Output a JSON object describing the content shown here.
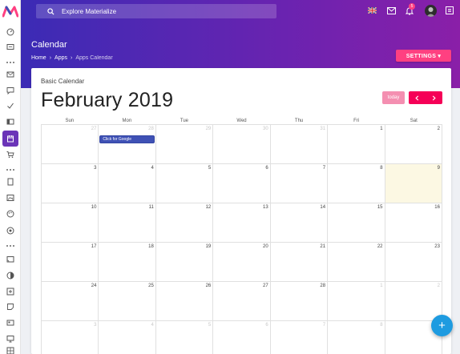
{
  "header": {
    "search_placeholder": "Explore Materialize",
    "notification_count": "5"
  },
  "page": {
    "title": "Calendar",
    "breadcrumb": [
      "Home",
      "Apps",
      "Apps Calendar"
    ],
    "settings_label": "SETTINGS ▾"
  },
  "calendar": {
    "card_title": "Basic Calendar",
    "month_label": "February 2019",
    "today_label": "today",
    "weekdays": [
      "Sun",
      "Mon",
      "Tue",
      "Wed",
      "Thu",
      "Fri",
      "Sat"
    ],
    "weeks": [
      [
        {
          "n": "27",
          "other": true
        },
        {
          "n": "28",
          "other": true,
          "event": "Click for Google"
        },
        {
          "n": "29",
          "other": true
        },
        {
          "n": "30",
          "other": true
        },
        {
          "n": "31",
          "other": true
        },
        {
          "n": "1"
        },
        {
          "n": "2"
        }
      ],
      [
        {
          "n": "3"
        },
        {
          "n": "4"
        },
        {
          "n": "5"
        },
        {
          "n": "6"
        },
        {
          "n": "7"
        },
        {
          "n": "8"
        },
        {
          "n": "9",
          "today": true
        }
      ],
      [
        {
          "n": "10"
        },
        {
          "n": "11"
        },
        {
          "n": "12"
        },
        {
          "n": "13"
        },
        {
          "n": "14"
        },
        {
          "n": "15"
        },
        {
          "n": "16"
        }
      ],
      [
        {
          "n": "17"
        },
        {
          "n": "18"
        },
        {
          "n": "19"
        },
        {
          "n": "20"
        },
        {
          "n": "21"
        },
        {
          "n": "22"
        },
        {
          "n": "23"
        }
      ],
      [
        {
          "n": "24"
        },
        {
          "n": "25"
        },
        {
          "n": "26"
        },
        {
          "n": "27"
        },
        {
          "n": "28"
        },
        {
          "n": "1",
          "other": true
        },
        {
          "n": "2",
          "other": true
        }
      ],
      [
        {
          "n": "3",
          "other": true
        },
        {
          "n": "4",
          "other": true
        },
        {
          "n": "5",
          "other": true
        },
        {
          "n": "6",
          "other": true
        },
        {
          "n": "7",
          "other": true
        },
        {
          "n": "8",
          "other": true
        },
        {
          "n": "9",
          "other": true
        }
      ]
    ]
  },
  "fab_label": "+",
  "colors": {
    "header_gradient_start": "#3b2bb5",
    "header_gradient_end": "#8a1fa8",
    "accent_pink": "#ff4081",
    "event_blue": "#3f51b5",
    "fab_blue": "#1e9be0",
    "today_highlight": "#fcf8e3"
  },
  "icons": {
    "rail": [
      "logo-icon",
      "dashboard-icon",
      "chat-icon",
      "dots",
      "mail-icon",
      "message-icon",
      "check-icon",
      "ui-icon",
      "calendar-icon",
      "cart-icon",
      "dots",
      "page-icon",
      "image-icon",
      "palette-icon",
      "target-icon",
      "dots",
      "cast-icon",
      "contrast-icon",
      "plus-box-icon",
      "note-icon",
      "card-icon",
      "monitor-icon",
      "grid-icon"
    ],
    "header": [
      "search-icon",
      "flag-icon",
      "mail-icon",
      "bell-icon",
      "avatar",
      "menu-icon"
    ]
  }
}
